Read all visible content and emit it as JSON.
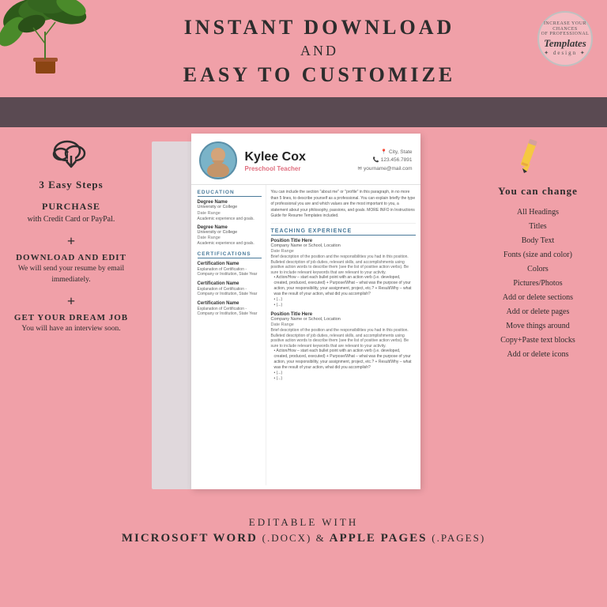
{
  "header": {
    "line1": "INSTANT DOWNLOAD",
    "line2": "AND",
    "line3": "EASY TO CUSTOMIZE"
  },
  "logo": {
    "top_text": "YOUR CHANGE",
    "brand": "Templates",
    "sub": "design"
  },
  "left_panel": {
    "steps_label": "3 Easy Steps",
    "purchase_title": "PURCHASE",
    "purchase_desc": "with Credit Card or PayPal.",
    "plus1": "+",
    "download_title": "DOWNLOAD AND EDIT",
    "download_desc": "We will send your resume by email immediately.",
    "plus2": "+",
    "dream_title": "GET YOUR DREAM JOB",
    "dream_desc": "You will have an interview soon."
  },
  "resume": {
    "name": "Kylee Cox",
    "job_title": "Preschool Teacher",
    "contact": {
      "city": "City, State",
      "phone": "123.456.7891",
      "email": "yourname@mail.com"
    },
    "summary": "You can include the section \"about me\" or \"profile\" in this paragraph, in no more than 5 lines, to describe yourself as a professional. You can explain briefly the type of professional you are and which values are the most important to you, a statement about your philosophy, passions, and goals. MORE INFO in Instructions Guide for Resume Templates included.",
    "education_title": "EDUCATION",
    "education_items": [
      {
        "name": "Degree Name",
        "school": "University or College",
        "date": "Date Range",
        "desc": "Academic experience and goals."
      },
      {
        "name": "Degree Name",
        "school": "University or College",
        "date": "Date Range",
        "desc": "Academic experience and goals."
      }
    ],
    "certifications_title": "CERTIFICATIONS",
    "cert_items": [
      {
        "name": "Certification Name",
        "desc": "Explanation of Certification - Company or Institution, State Year"
      },
      {
        "name": "Certification Name",
        "desc": "Explanation of Certification - Company or Institution, State Year"
      },
      {
        "name": "Certification Name",
        "desc": "Explanation of Certification - Company or Institution, State Year"
      }
    ],
    "experience_title": "TEACHING EXPERIENCE",
    "experience_items": [
      {
        "title": "Position Title Here",
        "company": "Company Name or School, Location",
        "date": "Date Range",
        "desc": "Brief description of the position and the responsibilities you had in this position. Bulleted description of job duties, relevant skills, and accomplishments using positive action words to describe them (see the list of positive action verbs). Be sure to include relevant keywords that are relevant to your activity.",
        "bullets": [
          "Action/How - start each bullet point with an action verb (i.e. developed, created, produced, executed) + Purpose/What - what was the purpose of your action, your responsibility, your assignment, project, etc.? + Result/Why - what was the result of your action, what did you accomplish?",
          "(...)",
          "(...)"
        ]
      },
      {
        "title": "Position Title Here",
        "company": "Company Name or School, Location",
        "date": "Date Range",
        "desc": "Brief description of the position and the responsibilities you had in this position. Bulleted description of job duties, relevant skills, and accomplishments using positive action words to describe them (see the list of positive action verbs). Be sure to include relevant keywords that are relevant to your activity.",
        "bullets": [
          "Action/How - start each bullet point with an action verb (i.e. developed, created, produced, executed) + Purpose/What - what was the purpose of your action, your responsibility, your assignment, project, etc.? + Result/Why - what was the result of your action, what did you accomplish?",
          "(...)",
          "(...)"
        ]
      }
    ]
  },
  "right_panel": {
    "you_can_change": "You can change",
    "change_items": [
      "All Headings",
      "Titles",
      "Body Text",
      "Fonts (size and color)",
      "Colors",
      "Pictures/Photos",
      "Add or delete sections",
      "Add or delete pages",
      "Move things around",
      "Copy+Paste text blocks",
      "Add or delete icons"
    ]
  },
  "footer": {
    "line1": "EDITABLE WITH",
    "line2_part1": "MICROSOFT WORD",
    "line2_part2": "(.docx) &",
    "line2_part3": "APPLE PAGES",
    "line2_part4": "(.pages)"
  }
}
